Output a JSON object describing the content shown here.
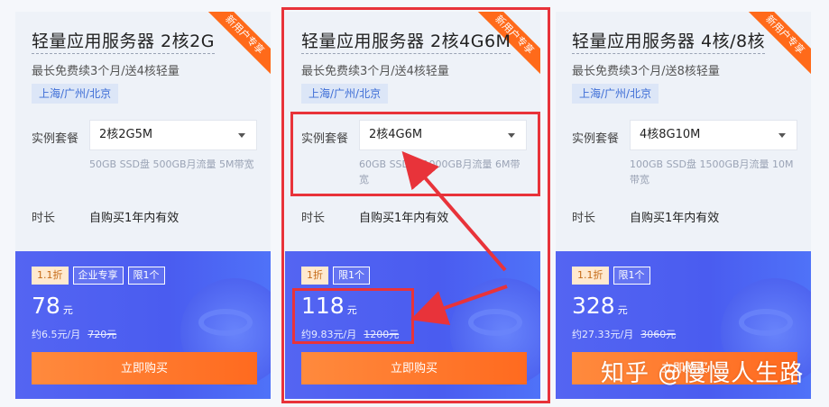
{
  "ribbon_label": "新用户专享",
  "spec_label": "实例套餐",
  "duration_label": "时长",
  "duration_value": "自购买1年内有效",
  "buy_label": "立即购买",
  "price_unit": "元",
  "cards": [
    {
      "title": "轻量应用服务器 2核2G",
      "subtitle": "最长免费续3个月/送4核轻量",
      "region": "上海/广州/北京",
      "spec_value": "2核2G5M",
      "spec_desc": "50GB SSD盘 500GB月流量 5M带宽",
      "badges": [
        "1.1折",
        "企业专享",
        "限1个"
      ],
      "price": "78",
      "monthly": "约6.5元/月",
      "original": "720元"
    },
    {
      "title": "轻量应用服务器 2核4G6M",
      "subtitle": "最长免费续3个月/送4核轻量",
      "region": "上海/广州/北京",
      "spec_value": "2核4G6M",
      "spec_desc": "60GB SSD盘 1000GB月流量 6M带宽",
      "badges": [
        "1折",
        "限1个"
      ],
      "price": "118",
      "monthly": "约9.83元/月",
      "original": "1200元"
    },
    {
      "title": "轻量应用服务器 4核/8核",
      "subtitle": "最长免费续3个月/送8核轻量",
      "region": "上海/广州/北京",
      "spec_value": "4核8G10M",
      "spec_desc": "100GB SSD盘 1500GB月流量 10M带宽",
      "badges": [
        "1.1折",
        "限1个"
      ],
      "price": "328",
      "monthly": "约27.33元/月",
      "original": "3060元"
    }
  ],
  "watermark": "知乎 @慢慢人生路",
  "colors": {
    "highlight": "#e8333a",
    "accent_orange": "#ff6a1f",
    "card_blue": "#4a5cf0"
  }
}
